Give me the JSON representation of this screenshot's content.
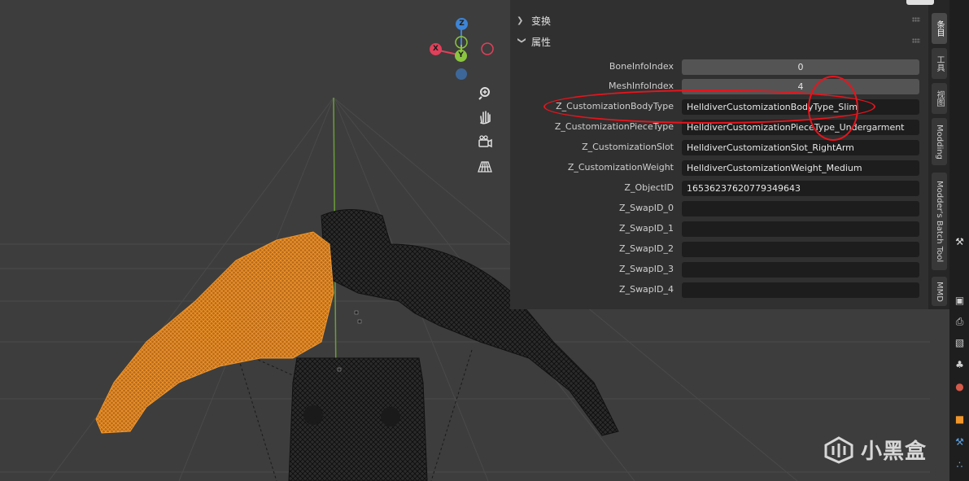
{
  "panel": {
    "sections": [
      {
        "label": "变换",
        "expanded": false
      },
      {
        "label": "属性",
        "expanded": true
      }
    ],
    "properties": [
      {
        "label": "BoneInfoIndex",
        "value": "0",
        "kind": "number"
      },
      {
        "label": "MeshInfoIndex",
        "value": "4",
        "kind": "number"
      },
      {
        "label": "Z_CustomizationBodyType",
        "value": "HelldiverCustomizationBodyType_Slim",
        "kind": "text"
      },
      {
        "label": "Z_CustomizationPieceType",
        "value": "HelldiverCustomizationPieceType_Undergarment",
        "kind": "text"
      },
      {
        "label": "Z_CustomizationSlot",
        "value": "HelldiverCustomizationSlot_RightArm",
        "kind": "text"
      },
      {
        "label": "Z_CustomizationWeight",
        "value": "HelldiverCustomizationWeight_Medium",
        "kind": "text"
      },
      {
        "label": "Z_ObjectID",
        "value": "16536237620779349643",
        "kind": "text"
      },
      {
        "label": "Z_SwapID_0",
        "value": "",
        "kind": "text"
      },
      {
        "label": "Z_SwapID_1",
        "value": "",
        "kind": "text"
      },
      {
        "label": "Z_SwapID_2",
        "value": "",
        "kind": "text"
      },
      {
        "label": "Z_SwapID_3",
        "value": "",
        "kind": "text"
      },
      {
        "label": "Z_SwapID_4",
        "value": "",
        "kind": "text"
      }
    ]
  },
  "side_tabs": [
    {
      "label": "条目",
      "active": true
    },
    {
      "label": "工具",
      "active": false
    },
    {
      "label": "视图",
      "active": false
    },
    {
      "label": "Modding",
      "active": false
    },
    {
      "label": "Modder's Batch Tool",
      "active": false
    },
    {
      "label": "MMD",
      "active": false
    }
  ],
  "gizmo": {
    "z_label": "Z",
    "x_label": "X",
    "y_label": "Y",
    "colors": {
      "x": "#e0405a",
      "y": "#8bc63f",
      "z": "#3d84d6"
    }
  },
  "nav_buttons": [
    "zoom-icon",
    "hand-pan-icon",
    "camera-icon",
    "grid-perspective-icon"
  ],
  "watermark": {
    "text": "小黑盒"
  },
  "colors": {
    "selected_mesh": "#f0962a",
    "annotation": "#e8141c",
    "panel_bg": "#303030"
  }
}
